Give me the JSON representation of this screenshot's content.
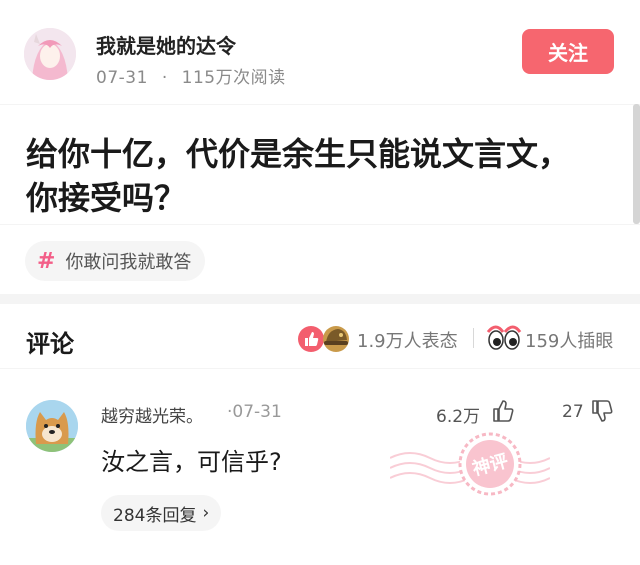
{
  "post": {
    "author_name": "我就是她的达令",
    "date": "07-31",
    "meta_separator": "·",
    "views": "115万次阅读",
    "follow_label": "关注",
    "title_line1": "给你十亿，代价是余生只能说文言文，",
    "title_line2": "你接受吗？",
    "tag": "你敢问我就敢答"
  },
  "comments_bar": {
    "title": "评论",
    "reactions_text": "1.9万人表态",
    "eyes_text": "159人插眼"
  },
  "comment": {
    "user": "越穷越光荣。",
    "date": "·07-31",
    "likes": "6.2万",
    "dislikes": "27",
    "text": "汝之言，可信乎?",
    "stamp_text": "神评",
    "replies": "284条回复"
  },
  "colors": {
    "accent": "#f6666f",
    "tag_hash": "#f35e88",
    "stamp": "#f7b8c4"
  }
}
